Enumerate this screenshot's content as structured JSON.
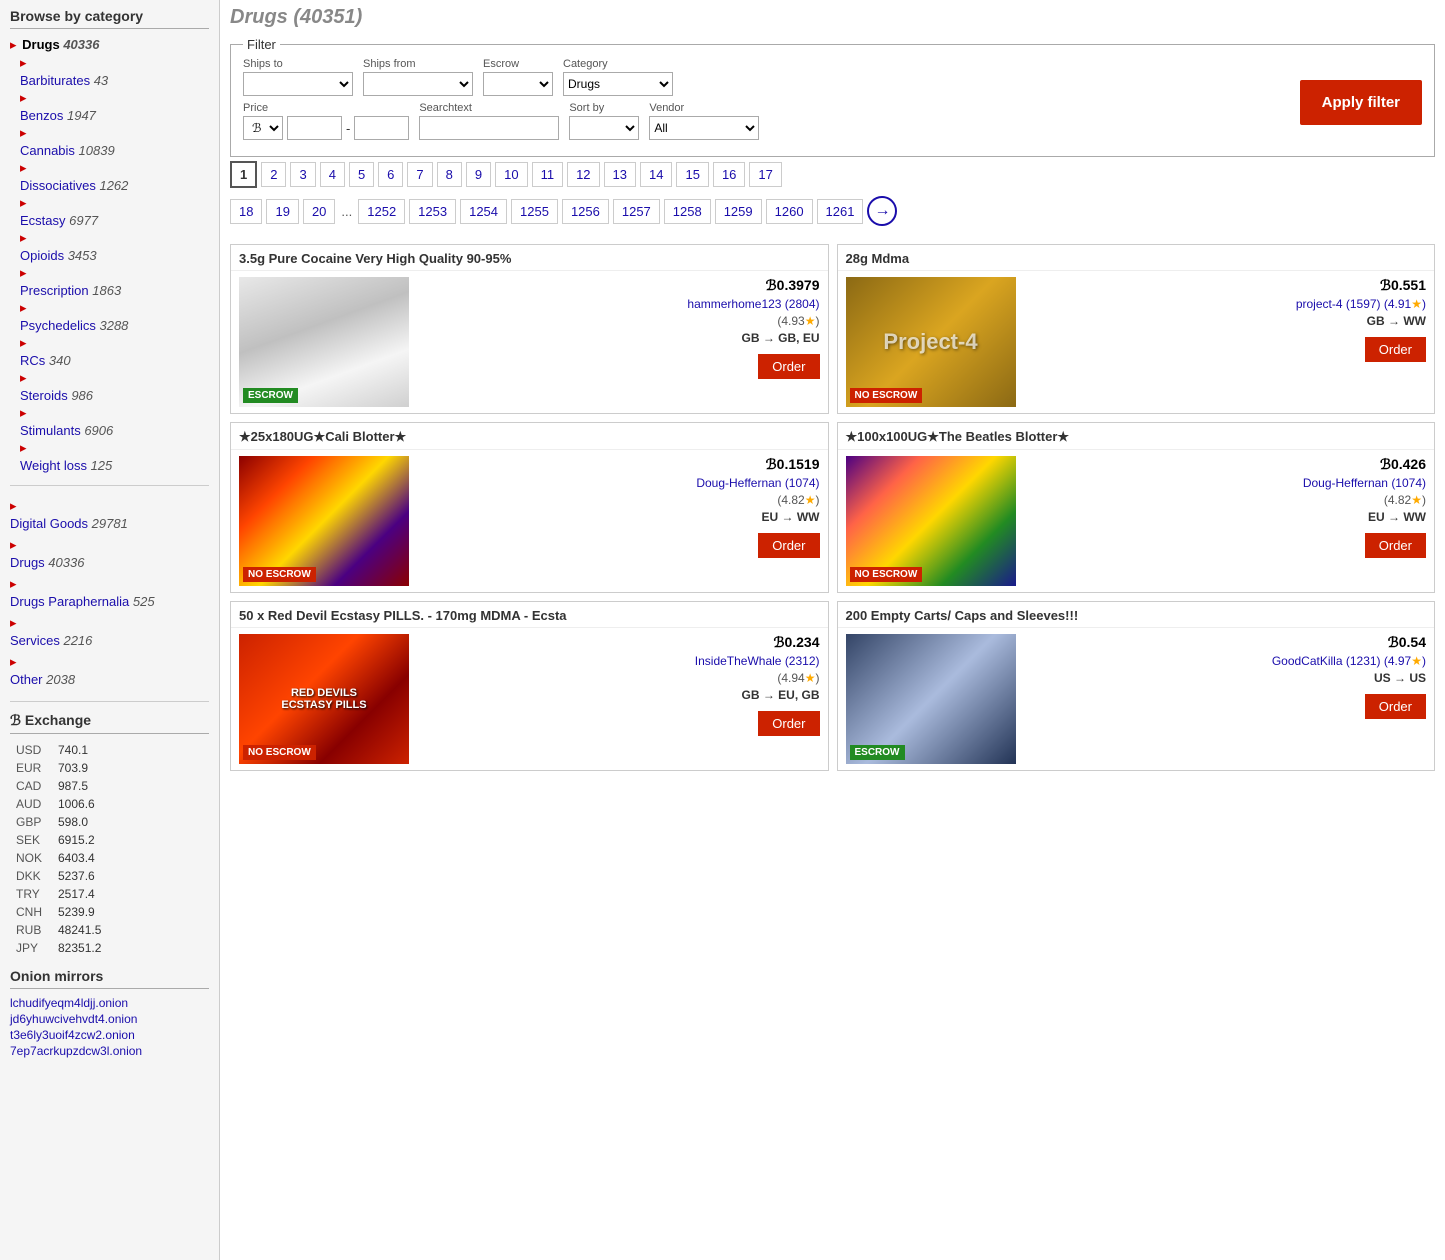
{
  "sidebar": {
    "section_title": "Browse by category",
    "categories": [
      {
        "label": "Drugs",
        "count": "40336",
        "active": true,
        "bullet": "▸",
        "indent": false
      },
      {
        "label": "Barbiturates",
        "count": "43",
        "indent": true
      },
      {
        "label": "Benzos",
        "count": "1947",
        "indent": true
      },
      {
        "label": "Cannabis",
        "count": "10839",
        "indent": true
      },
      {
        "label": "Dissociatives",
        "count": "1262",
        "indent": true
      },
      {
        "label": "Ecstasy",
        "count": "6977",
        "indent": true
      },
      {
        "label": "Opioids",
        "count": "3453",
        "indent": true
      },
      {
        "label": "Prescription",
        "count": "1863",
        "indent": true
      },
      {
        "label": "Psychedelics",
        "count": "3288",
        "indent": true
      },
      {
        "label": "RCs",
        "count": "340",
        "indent": true
      },
      {
        "label": "Steroids",
        "count": "986",
        "indent": true
      },
      {
        "label": "Stimulants",
        "count": "6906",
        "indent": true
      },
      {
        "label": "Weight loss",
        "count": "125",
        "indent": true
      }
    ],
    "main_categories": [
      {
        "label": "Digital Goods",
        "count": "29781"
      },
      {
        "label": "Drugs",
        "count": "40336"
      },
      {
        "label": "Drugs Paraphernalia",
        "count": "525"
      },
      {
        "label": "Services",
        "count": "2216"
      },
      {
        "label": "Other",
        "count": "2038"
      }
    ],
    "exchange_title": "ℬ Exchange",
    "exchange_rates": [
      {
        "currency": "USD",
        "rate": "740.1"
      },
      {
        "currency": "EUR",
        "rate": "703.9"
      },
      {
        "currency": "CAD",
        "rate": "987.5"
      },
      {
        "currency": "AUD",
        "rate": "1006.6"
      },
      {
        "currency": "GBP",
        "rate": "598.0"
      },
      {
        "currency": "SEK",
        "rate": "6915.2"
      },
      {
        "currency": "NOK",
        "rate": "6403.4"
      },
      {
        "currency": "DKK",
        "rate": "5237.6"
      },
      {
        "currency": "TRY",
        "rate": "2517.4"
      },
      {
        "currency": "CNH",
        "rate": "5239.9"
      },
      {
        "currency": "RUB",
        "rate": "48241.5"
      },
      {
        "currency": "JPY",
        "rate": "82351.2"
      }
    ],
    "onion_title": "Onion mirrors",
    "onion_links": [
      "lchudifyeqm4ldjj.onion",
      "jd6yhuwcivehvdt4.onion",
      "t3e6ly3uoif4zcw2.onion",
      "7ep7acrkupzdcw3l.onion"
    ]
  },
  "main": {
    "page_title": "Drugs (40351)",
    "filter": {
      "legend": "Filter",
      "ships_to_label": "Ships to",
      "ships_from_label": "Ships from",
      "escrow_label": "Escrow",
      "category_label": "Category",
      "category_value": "Drugs",
      "price_label": "Price",
      "price_symbol": "ℬ",
      "sort_by_label": "Sort by",
      "vendor_label": "Vendor",
      "vendor_value": "All",
      "searchtext_label": "Searchtext",
      "apply_label": "Apply filter"
    },
    "pagination": {
      "pages_row1": [
        "1",
        "2",
        "3",
        "4",
        "5",
        "6",
        "7",
        "8",
        "9",
        "10",
        "11",
        "12",
        "13",
        "14",
        "15",
        "16",
        "17"
      ],
      "pages_row2": [
        "18",
        "19",
        "20",
        "...",
        "1252",
        "1253",
        "1254",
        "1255",
        "1256",
        "1257",
        "1258",
        "1259",
        "1260",
        "1261"
      ]
    },
    "products": [
      {
        "title": "3.5g Pure Cocaine Very High Quality 90-95%",
        "price": "ℬ0.3979",
        "vendor": "hammerhome123 (2804)",
        "rating": "(4.93★)",
        "shipping": "GB → GB, EU",
        "escrow": "ESCROW",
        "escrow_type": "escrow",
        "img_class": "img-cocaine",
        "img_text": ""
      },
      {
        "title": "28g Mdma",
        "price": "ℬ0.551",
        "vendor": "project-4 (1597) (4.91★)",
        "rating": "",
        "shipping": "GB → WW",
        "escrow": "NO ESCROW",
        "escrow_type": "no-escrow",
        "img_class": "img-mdma",
        "img_text": "Project-4"
      },
      {
        "title": "★25x180UG★Cali Blotter★",
        "price": "ℬ0.1519",
        "vendor": "Doug-Heffernan (1074)",
        "rating": "(4.82★)",
        "shipping": "EU → WW",
        "escrow": "NO ESCROW",
        "escrow_type": "no-escrow",
        "img_class": "img-blotter1",
        "img_text": ""
      },
      {
        "title": "★100x100UG★The Beatles Blotter★",
        "price": "ℬ0.426",
        "vendor": "Doug-Heffernan (1074)",
        "rating": "(4.82★)",
        "shipping": "EU → WW",
        "escrow": "NO ESCROW",
        "escrow_type": "no-escrow",
        "img_class": "img-blotter2",
        "img_text": ""
      },
      {
        "title": "50 x Red Devil Ecstasy PILLS. - 170mg MDMA - Ecsta",
        "price": "ℬ0.234",
        "vendor": "InsideTheWhale (2312)",
        "rating": "(4.94★)",
        "shipping": "GB → EU, GB",
        "escrow": "NO ESCROW",
        "escrow_type": "no-escrow",
        "img_class": "img-pills",
        "img_text": ""
      },
      {
        "title": "200 Empty Carts/ Caps and Sleeves!!!",
        "price": "ℬ0.54",
        "vendor": "GoodCatKilla (1231) (4.97★)",
        "rating": "",
        "shipping": "US → US",
        "escrow": "ESCROW",
        "escrow_type": "escrow",
        "img_class": "img-carts",
        "img_text": ""
      }
    ],
    "order_label": "Order"
  }
}
